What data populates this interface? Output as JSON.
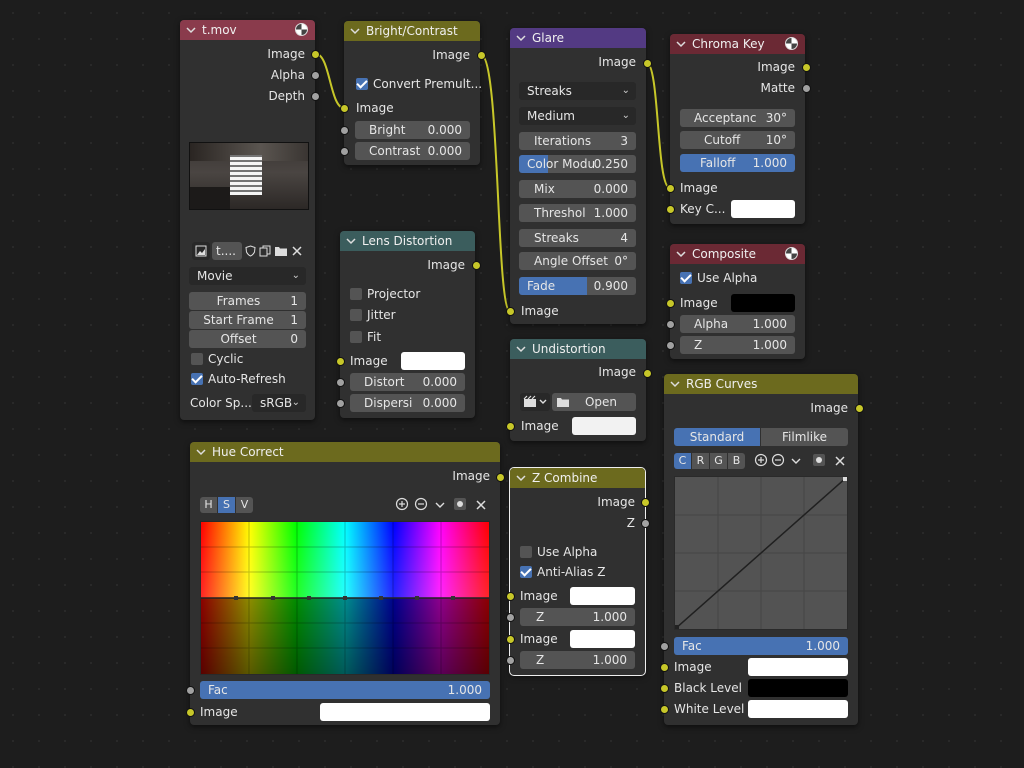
{
  "nodes": {
    "movie": {
      "title": "t.mov",
      "outputs": [
        "Image",
        "Alpha",
        "Depth"
      ],
      "file_name": "t....",
      "source": "Movie",
      "fields": [
        {
          "label": "Frames",
          "value": "1"
        },
        {
          "label": "Start Frame",
          "value": "1"
        },
        {
          "label": "Offset",
          "value": "0"
        }
      ],
      "cyclic": "Cyclic",
      "auto_refresh": "Auto-Refresh",
      "color_space_label": "Color Sp...",
      "color_space_value": "sRGB"
    },
    "bright": {
      "title": "Bright/Contrast",
      "output": "Image",
      "convert": "Convert Premult...",
      "input": "Image",
      "fields": [
        {
          "label": "Bright",
          "value": "0.000"
        },
        {
          "label": "Contrast",
          "value": "0.000"
        }
      ]
    },
    "glare": {
      "title": "Glare",
      "output": "Image",
      "type": "Streaks",
      "quality": "Medium",
      "fields": [
        {
          "label": "Iterations",
          "value": "3"
        },
        {
          "label": "Color Modu",
          "value": "0.250"
        },
        {
          "label": "Mix",
          "value": "0.000"
        },
        {
          "label": "Threshol",
          "value": "1.000"
        },
        {
          "label": "Streaks",
          "value": "4"
        },
        {
          "label": "Angle Offset",
          "value": "0°"
        },
        {
          "label": "Fade",
          "value": "0.900"
        }
      ],
      "input": "Image"
    },
    "chroma": {
      "title": "Chroma Key",
      "outputs": [
        "Image",
        "Matte"
      ],
      "fields": [
        {
          "label": "Acceptanc",
          "value": "30°"
        },
        {
          "label": "Cutoff",
          "value": "10°"
        },
        {
          "label": "Falloff",
          "value": "1.000"
        }
      ],
      "inputs": [
        "Image",
        "Key C..."
      ]
    },
    "lens": {
      "title": "Lens Distortion",
      "output": "Image",
      "checks": [
        "Projector",
        "Jitter",
        "Fit"
      ],
      "input": "Image",
      "fields": [
        {
          "label": "Distort",
          "value": "0.000"
        },
        {
          "label": "Dispersi",
          "value": "0.000"
        }
      ]
    },
    "composite": {
      "title": "Composite",
      "use_alpha": "Use Alpha",
      "input": "Image",
      "fields": [
        {
          "label": "Alpha",
          "value": "1.000"
        },
        {
          "label": "Z",
          "value": "1.000"
        }
      ]
    },
    "undist": {
      "title": "Undistortion",
      "output": "Image",
      "open": "Open",
      "input": "Image"
    },
    "rgb": {
      "title": "RGB Curves",
      "output": "Image",
      "tabs": [
        "Standard",
        "Filmlike"
      ],
      "channels": [
        "C",
        "R",
        "G",
        "B"
      ],
      "fac_label": "Fac",
      "fac_value": "1.000",
      "inputs": [
        "Image",
        "Black Level",
        "White Level"
      ]
    },
    "hue": {
      "title": "Hue Correct",
      "output": "Image",
      "channels": [
        "H",
        "S",
        "V"
      ],
      "fac_label": "Fac",
      "fac_value": "1.000",
      "input": "Image"
    },
    "zcomb": {
      "title": "Z Combine",
      "outputs": [
        "Image",
        "Z"
      ],
      "checks": [
        "Use Alpha",
        "Anti-Alias Z"
      ],
      "rows": [
        {
          "label": "Image"
        },
        {
          "label": "Z",
          "value": "1.000"
        },
        {
          "label": "Image"
        },
        {
          "label": "Z",
          "value": "1.000"
        }
      ]
    }
  },
  "colors": {
    "socket_color": "#c7c729",
    "socket_value": "#a1a1a1",
    "wire": "#c7c729",
    "accent": "#4772b3"
  }
}
